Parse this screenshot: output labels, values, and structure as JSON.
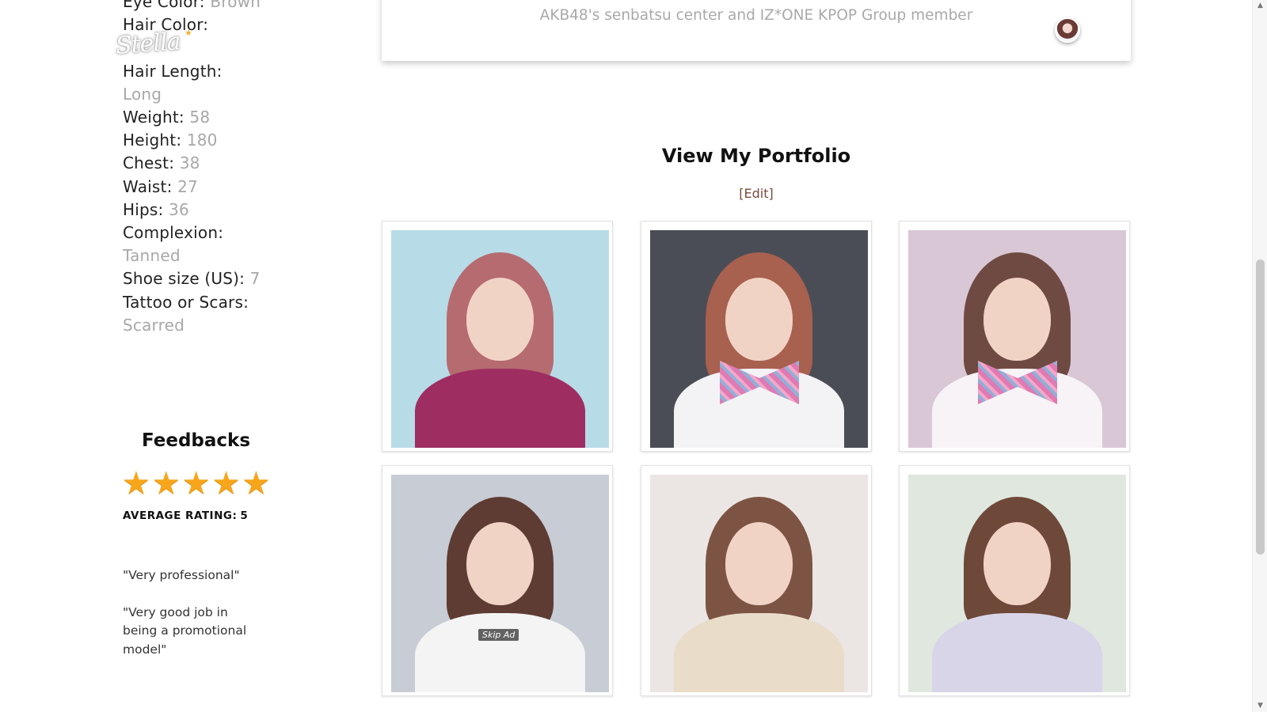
{
  "profile": {
    "attributes": [
      {
        "label": "Eye Color:",
        "value": "Brown",
        "inline": true
      },
      {
        "label": "Hair Color:",
        "value": "",
        "inline": false
      },
      {
        "label": "Hair Length:",
        "value": "Long",
        "inline": false
      },
      {
        "label": "Weight:",
        "value": "58",
        "inline": true
      },
      {
        "label": "Height:",
        "value": "180",
        "inline": true
      },
      {
        "label": "Chest:",
        "value": "38",
        "inline": true
      },
      {
        "label": "Waist:",
        "value": "27",
        "inline": true
      },
      {
        "label": "Hips:",
        "value": "36",
        "inline": true
      },
      {
        "label": "Complexion:",
        "value": "Tanned",
        "inline": false
      },
      {
        "label": "Shoe size (US):",
        "value": "7",
        "inline": true
      },
      {
        "label": "Tattoo or Scars:",
        "value": "Scarred",
        "inline": false
      }
    ],
    "logo_text": "Stella"
  },
  "feedbacks": {
    "title": "Feedbacks",
    "rating_stars": 5,
    "average_label": "AVERAGE RATING:",
    "average_value": "5",
    "items": [
      "\"Very professional\"",
      "\"Very good job in being a promotional model\""
    ]
  },
  "bio": {
    "text": "AKB48's senbatsu center and IZ*ONE KPOP Group member"
  },
  "portfolio": {
    "title": "View My Portfolio",
    "edit_label": "[Edit]",
    "overlay_text": "Skip Ad",
    "photos": [
      {
        "bg": "#b8dbe8",
        "hair": "#b56b6f",
        "body": "#9e2d62"
      },
      {
        "bg": "#4a4d56",
        "hair": "#a8604f",
        "body": "#f3f3f6"
      },
      {
        "bg": "#d9c7d6",
        "hair": "#6f4a42",
        "body": "#f7f3f6"
      },
      {
        "bg": "#c7ccd5",
        "hair": "#5e3c33",
        "body": "#f4f4f4"
      },
      {
        "bg": "#ebe6e3",
        "hair": "#7d5444",
        "body": "#e9ddc9"
      },
      {
        "bg": "#dfe7df",
        "hair": "#6e4838",
        "body": "#d9d5e8"
      }
    ]
  },
  "colors": {
    "star": "#f7a61c",
    "value_text": "#a8a8a8",
    "edit_link": "#7a4a3e"
  }
}
